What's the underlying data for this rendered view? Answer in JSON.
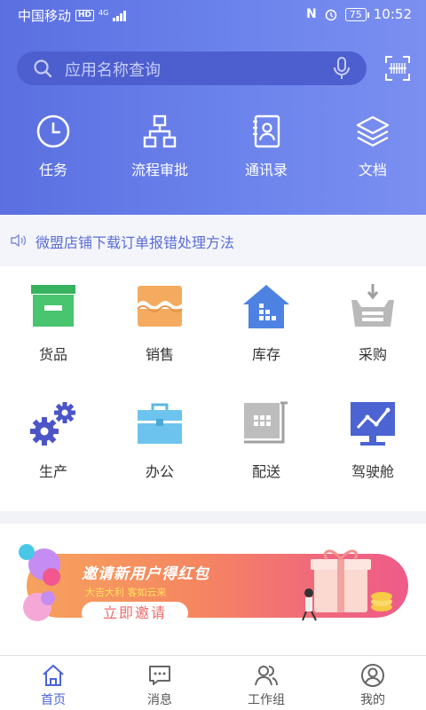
{
  "status_bar": {
    "carrier": "中国移动",
    "network_badge": "HD",
    "network_type": "4G",
    "battery": "75",
    "time": "10:52"
  },
  "search": {
    "placeholder": "应用名称查询",
    "mic_icon": "microphone-icon",
    "scan_icon": "scan-icon"
  },
  "quick_actions": [
    {
      "label": "任务",
      "icon": "clock-icon"
    },
    {
      "label": "流程审批",
      "icon": "org-chart-icon"
    },
    {
      "label": "通讯录",
      "icon": "contacts-icon"
    },
    {
      "label": "文档",
      "icon": "layers-icon"
    }
  ],
  "notice": {
    "text": "微盟店铺下载订单报错处理方法",
    "icon": "speaker-icon"
  },
  "apps": [
    {
      "label": "货品",
      "icon": "box-icon",
      "color": "#3fbf6b"
    },
    {
      "label": "销售",
      "icon": "storefront-icon",
      "color": "#f3a55a"
    },
    {
      "label": "库存",
      "icon": "warehouse-icon",
      "color": "#4d82e2"
    },
    {
      "label": "采购",
      "icon": "inbox-icon",
      "color": "#b7b7b7"
    },
    {
      "label": "生产",
      "icon": "gears-icon",
      "color": "#4b55c8"
    },
    {
      "label": "办公",
      "icon": "briefcase-icon",
      "color": "#6cc4ee"
    },
    {
      "label": "配送",
      "icon": "cart-icon",
      "color": "#a9a9a9"
    },
    {
      "label": "驾驶舱",
      "icon": "dashboard-icon",
      "color": "#4b64d2"
    }
  ],
  "banner": {
    "title": "邀请新用户得红包",
    "subtitle": "大吉大利  客如云来",
    "button": "立即邀请"
  },
  "tabs": [
    {
      "label": "首页",
      "icon": "home-icon",
      "active": true
    },
    {
      "label": "消息",
      "icon": "message-icon",
      "active": false
    },
    {
      "label": "工作组",
      "icon": "group-icon",
      "active": false
    },
    {
      "label": "我的",
      "icon": "user-icon",
      "active": false
    }
  ],
  "colors": {
    "accent": "#4a63d8",
    "header_start": "#5b6fe0",
    "header_end": "#7b8ff0"
  }
}
